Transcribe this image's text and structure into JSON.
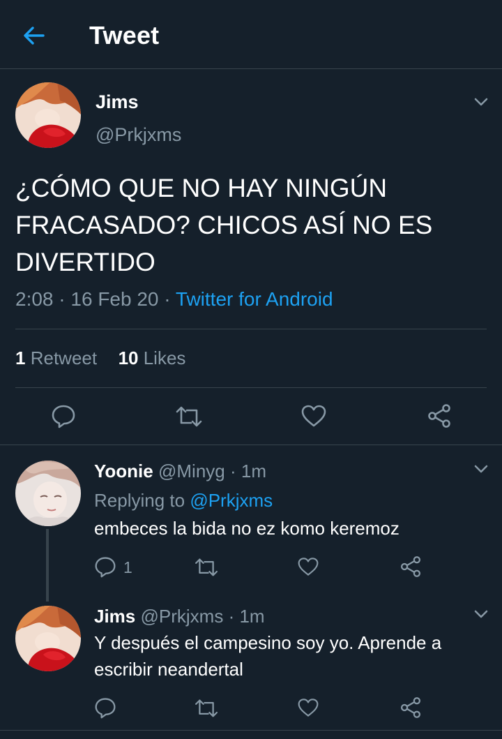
{
  "header": {
    "title": "Tweet"
  },
  "main_tweet": {
    "name": "Jims",
    "handle": "@Prkjxms",
    "text": "¿CÓMO QUE NO HAY NINGÚN FRACASADO? CHICOS ASÍ NO ES DIVERTIDO",
    "time": "2:08",
    "date": "16 Feb 20",
    "source": "Twitter for Android",
    "retweet_count": "1",
    "retweet_label": "Retweet",
    "like_count": "10",
    "like_label": "Likes"
  },
  "replies": [
    {
      "name": "Yoonie",
      "handle": "@Minyg",
      "time": "1m",
      "replying_prefix": "Replying to",
      "replying_to": "@Prkjxms",
      "text": "embeces la bida no ez komo keremoz",
      "reply_count": "1"
    },
    {
      "name": "Jims",
      "handle": "@Prkjxms",
      "time": "1m",
      "text": "Y después el campesino soy yo. Aprende a escribir neandertal"
    }
  ],
  "separator": "·",
  "colors": {
    "background": "#15202b",
    "accent": "#1da1f2",
    "muted": "#8899a6",
    "divider": "#38444d"
  },
  "icons": [
    "back-arrow-icon",
    "chevron-down-icon",
    "reply-icon",
    "retweet-icon",
    "like-icon",
    "share-icon"
  ]
}
